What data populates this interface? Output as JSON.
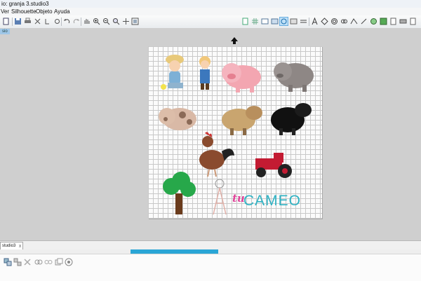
{
  "window": {
    "title": "io: granja 3.studio3"
  },
  "menu": {
    "items": [
      "Ver",
      "Silhouette",
      "Objeto",
      "Ayuda"
    ]
  },
  "workspace": {
    "page_label": "sio"
  },
  "canvas": {
    "artwork": [
      "farmer-girl-with-chick",
      "farmer-boy",
      "pink-pig",
      "gray-pig",
      "spotted-pig",
      "tan-sheep",
      "black-sheep",
      "rooster",
      "red-tractor",
      "green-tree",
      "windmill"
    ],
    "logo": {
      "script": "tu",
      "word": "CAMEO"
    }
  },
  "tabs": {
    "document": "studio3",
    "close": "x"
  },
  "scroll": {
    "thumb_fraction": 0.21
  },
  "colors": {
    "accent": "#2aa6d6",
    "logo_pink": "#e0459a",
    "logo_teal": "#2fb2c3",
    "workspace": "#cfcfcf"
  },
  "toolbar_icons": {
    "left": [
      "new-page-icon",
      "open-icon",
      "save-icon",
      "print-icon",
      "cut-send-icon",
      "print-cut-icon",
      "undo-icon",
      "redo-icon",
      "pan-hand-icon",
      "zoom-in-icon",
      "zoom-out-icon",
      "zoom-select-icon",
      "pan-drag-icon",
      "fit-to-page-icon"
    ],
    "right": [
      "page-setup-icon",
      "grid-icon",
      "registration-icon",
      "cut-settings-icon",
      "fill-color-icon",
      "line-color-icon",
      "text-icon",
      "points-icon",
      "offset-icon",
      "replicate-icon",
      "trace-icon",
      "knife-icon",
      "store-icon",
      "library-icon",
      "design-icon",
      "media-icon",
      "send-icon"
    ]
  },
  "bottom_icons": [
    "group-icon",
    "ungroup-icon",
    "delete-icon",
    "compound-path-icon",
    "release-compound-icon",
    "duplicate-icon",
    "weld-icon",
    "target-icon"
  ]
}
